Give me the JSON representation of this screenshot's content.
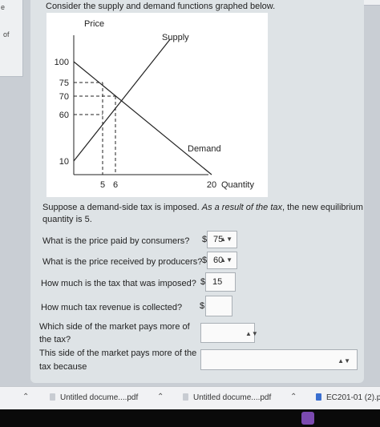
{
  "sidebar": {
    "letter": "e",
    "of_label": "of"
  },
  "prompt": "Consider the supply and demand functions graphed below.",
  "graph": {
    "y_axis_label": "Price",
    "x_axis_label": "Quantity",
    "supply_label": "Supply",
    "demand_label": "Demand",
    "y_ticks": [
      "100",
      "75",
      "70",
      "60",
      "10"
    ],
    "x_ticks": [
      "5",
      "6",
      "20"
    ]
  },
  "chart_data": {
    "type": "line",
    "xlabel": "Quantity",
    "ylabel": "Price",
    "series": [
      {
        "name": "Supply",
        "x": [
          0,
          14
        ],
        "y": [
          10,
          120
        ]
      },
      {
        "name": "Demand",
        "x": [
          0,
          20
        ],
        "y": [
          100,
          0
        ]
      }
    ],
    "reference_lines": [
      {
        "y": 75,
        "x_to": 5
      },
      {
        "y": 70,
        "x_to": 6
      },
      {
        "y": 60,
        "x_to": 5
      },
      {
        "x": 5,
        "y_to": 75
      },
      {
        "x": 6,
        "y_to": 70
      }
    ]
  },
  "scenario": {
    "line1_normal": "Suppose a demand-side tax is imposed. ",
    "line1_italic": "As a result of the tax",
    "line1_end": ", the new equilibrium",
    "line2": "quantity is 5."
  },
  "questions": [
    {
      "text": "What is the price paid by consumers?",
      "prefix": "$",
      "value": "75"
    },
    {
      "text": "What is the price received by producers?",
      "prefix": "$",
      "value": "60"
    },
    {
      "text": "How much is the tax that was imposed?",
      "prefix": "$",
      "value": "15"
    },
    {
      "text": "How much tax revenue is collected?",
      "prefix": "$",
      "value": ""
    }
  ],
  "side_q1": {
    "line1": "Which side of the market pays more of",
    "line2": "the tax?"
  },
  "side_q2": {
    "line1": "This side of the market pays more of the",
    "line2": "tax because"
  },
  "downloads": [
    {
      "name": "Untitled docume....pdf"
    },
    {
      "name": "Untitled docume....pdf"
    },
    {
      "name": "EC201-01 (2).p"
    }
  ]
}
